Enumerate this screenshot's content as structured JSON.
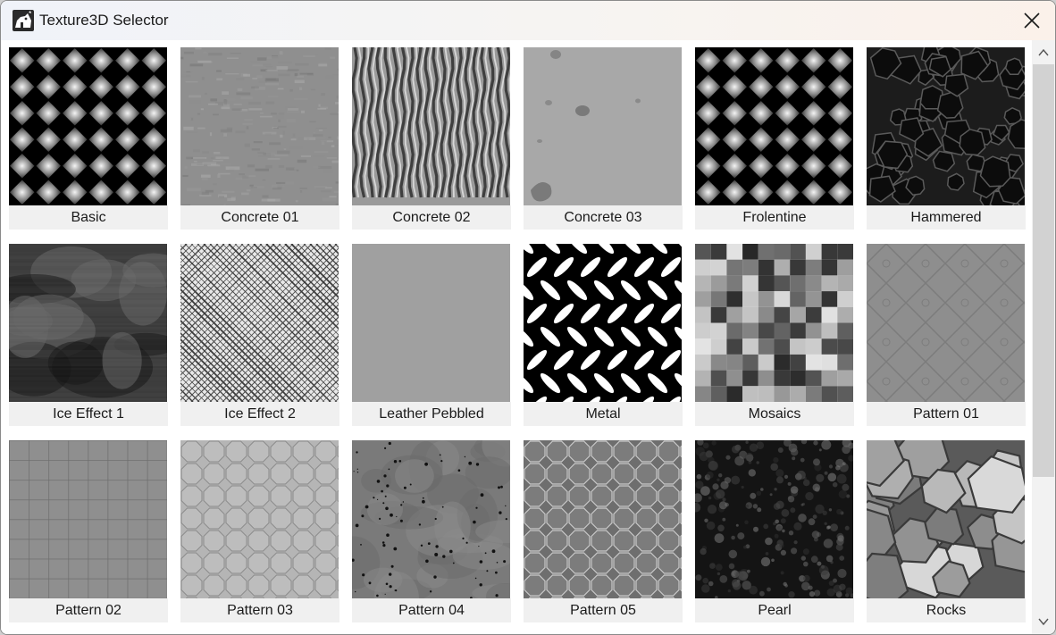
{
  "window": {
    "title": "Texture3D Selector",
    "icons": {
      "app": "rhino-app-icon",
      "close": "close-icon"
    }
  },
  "textures": [
    {
      "name": "Basic",
      "pattern": "diamond-grid"
    },
    {
      "name": "Concrete 01",
      "pattern": "concrete"
    },
    {
      "name": "Concrete 02",
      "pattern": "vertical-waves"
    },
    {
      "name": "Concrete 03",
      "pattern": "concrete-spots"
    },
    {
      "name": "Frolentine",
      "pattern": "diamond-grid"
    },
    {
      "name": "Hammered",
      "pattern": "voronoi-dark"
    },
    {
      "name": "Ice Effect 1",
      "pattern": "dark-streaks"
    },
    {
      "name": "Ice Effect 2",
      "pattern": "crosshatch"
    },
    {
      "name": "Leather Pebbled",
      "pattern": "flat-gray"
    },
    {
      "name": "Metal",
      "pattern": "diamond-plate"
    },
    {
      "name": "Mosaics",
      "pattern": "checker-mosaic"
    },
    {
      "name": "Pattern 01",
      "pattern": "thin-diamond"
    },
    {
      "name": "Pattern 02",
      "pattern": "square-grid"
    },
    {
      "name": "Pattern 03",
      "pattern": "octagon-light"
    },
    {
      "name": "Pattern 04",
      "pattern": "speckled"
    },
    {
      "name": "Pattern 05",
      "pattern": "octagon-dark"
    },
    {
      "name": "Pearl",
      "pattern": "pearl-noise"
    },
    {
      "name": "Rocks",
      "pattern": "rocks"
    }
  ],
  "scrollbar": {
    "icons": {
      "up": "scroll-up-icon",
      "down": "scroll-down-icon"
    }
  }
}
